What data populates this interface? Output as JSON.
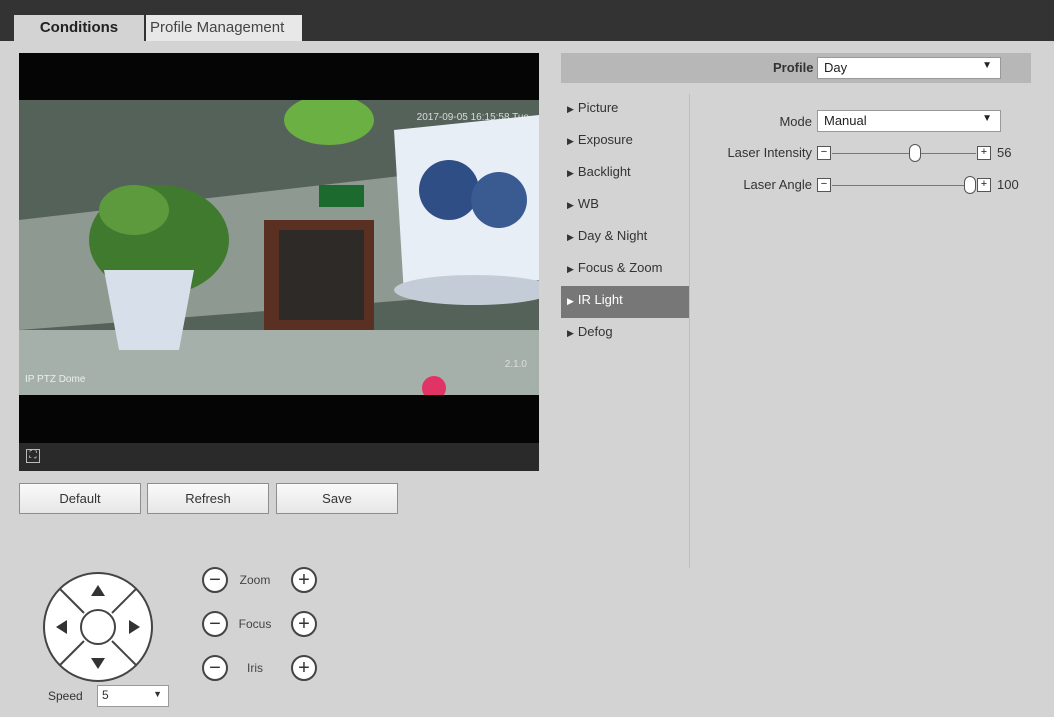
{
  "tabs": {
    "active": "Conditions",
    "inactive": "Profile Management"
  },
  "video": {
    "timestamp": "2017-09-05 16:15:58 Tue",
    "camera_name": "IP PTZ Dome",
    "zoom": "2.1.0",
    "fullscreen_icon": "fullscreen-icon"
  },
  "actions": {
    "default": "Default",
    "refresh": "Refresh",
    "save": "Save"
  },
  "ptz": {
    "zoom_label": "Zoom",
    "focus_label": "Focus",
    "iris_label": "Iris",
    "minus": "−",
    "plus": "+",
    "speed_label": "Speed",
    "speed_value": "5"
  },
  "profile": {
    "label": "Profile",
    "value": "Day"
  },
  "menu": [
    {
      "label": "Picture"
    },
    {
      "label": "Exposure"
    },
    {
      "label": "Backlight"
    },
    {
      "label": "WB"
    },
    {
      "label": "Day & Night"
    },
    {
      "label": "Focus & Zoom"
    },
    {
      "label": "IR Light",
      "active": true
    },
    {
      "label": "Defog"
    }
  ],
  "settings": {
    "mode_label": "Mode",
    "mode_value": "Manual",
    "laser_intensity_label": "Laser Intensity",
    "laser_intensity_value": "56",
    "laser_angle_label": "Laser Angle",
    "laser_angle_value": "100"
  },
  "colors": {
    "menu_active": "#777777",
    "topbar": "#333333",
    "background": "#d3d3d3"
  }
}
